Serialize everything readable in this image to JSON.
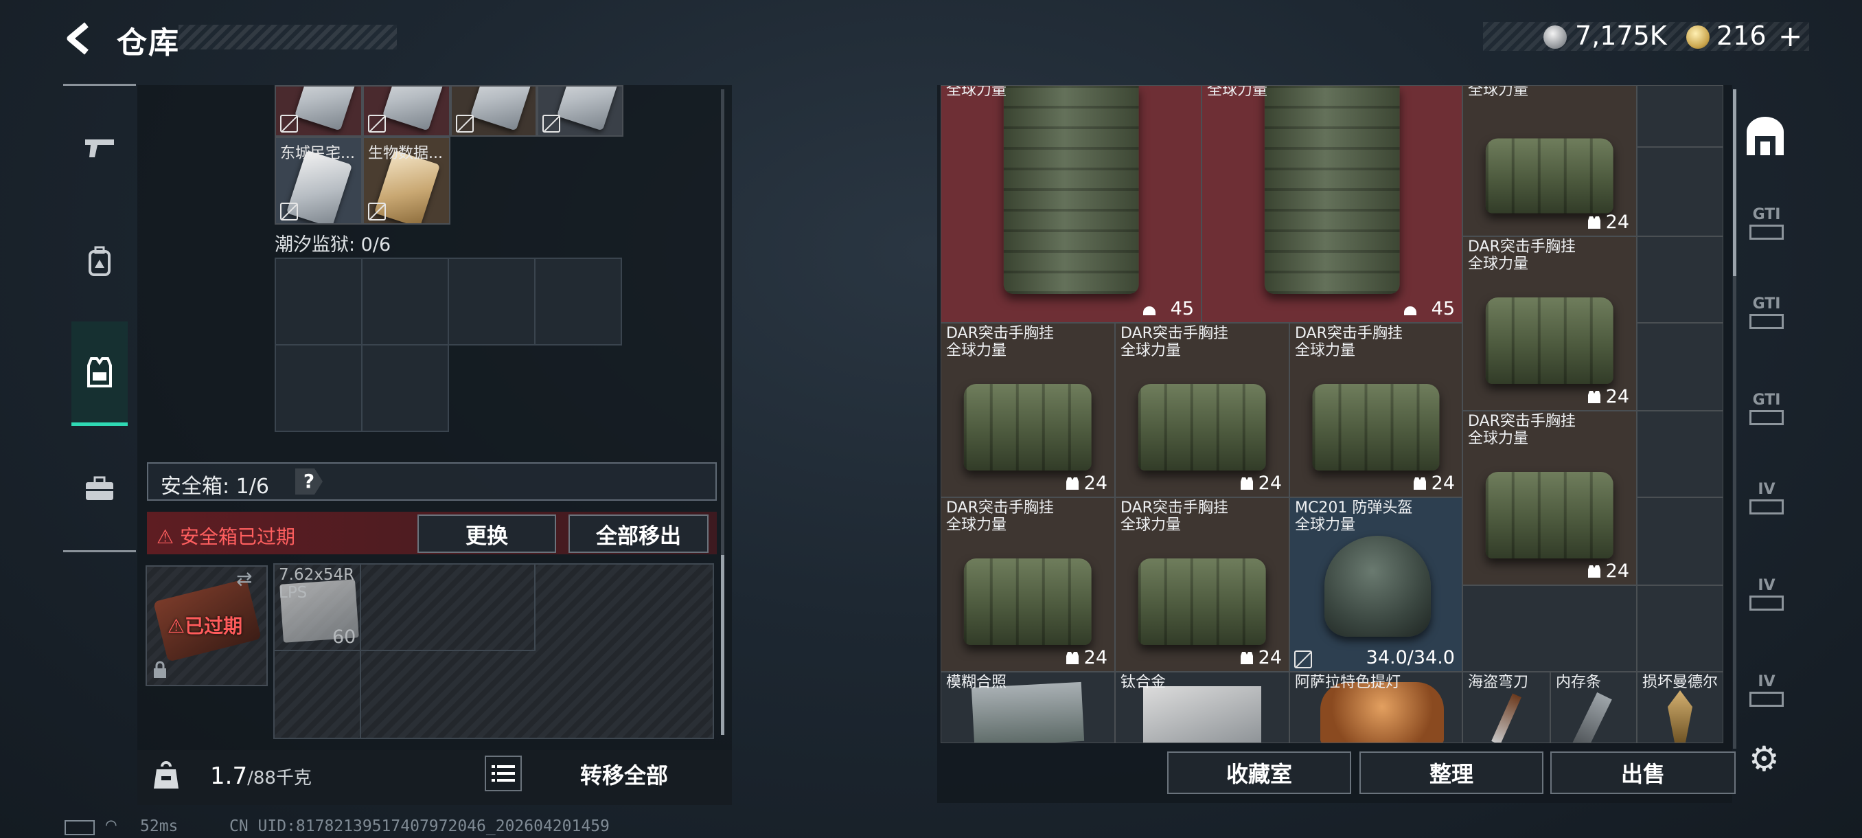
{
  "header": {
    "back_icon": "chevron-left-icon",
    "title": "仓库",
    "currency": [
      {
        "icon": "silver-coin-icon",
        "value": "7,175K"
      },
      {
        "icon": "gold-coin-icon",
        "value": "216"
      }
    ],
    "add_label": "+"
  },
  "left_nav": [
    {
      "icon": "gun-icon",
      "active": false
    },
    {
      "icon": "backpack-icon",
      "active": false
    },
    {
      "icon": "vest-icon",
      "active": true
    },
    {
      "icon": "briefcase-icon",
      "active": false
    }
  ],
  "left_panel": {
    "cards": [
      {
        "label": "东城民宅..."
      },
      {
        "label": "生物数据..."
      }
    ],
    "prison_label": "潮汐监狱: 0/6",
    "safe_box_label": "安全箱: 1/6",
    "help_label": "?",
    "warning_text": "安全箱已过期",
    "replace_button": "更换",
    "move_all_button": "全部移出",
    "expired_label": "已过期",
    "ammo": {
      "name": "7.62x54R",
      "sub": "LPS",
      "count": "60"
    },
    "weight_value": "1.7",
    "weight_max": "/88千克",
    "transfer_all_button": "转移全部"
  },
  "right_panel": {
    "items": [
      {
        "label": "全球力量",
        "count": "45",
        "count_icon": "helmet-icon"
      },
      {
        "label": "全球力量",
        "count": "45",
        "count_icon": "helmet-icon"
      },
      {
        "label": "全球力量",
        "count": "24",
        "count_icon": "vest-icon"
      },
      {
        "label": "DAR突击手胸挂\n全球力量",
        "count": "24",
        "count_icon": "vest-icon"
      },
      {
        "label": "DAR突击手胸挂\n全球力量",
        "count": "24",
        "count_icon": "vest-icon"
      },
      {
        "label": "DAR突击手胸挂\n全球力量",
        "count": "24",
        "count_icon": "vest-icon"
      },
      {
        "label": "DAR突击手胸挂\n全球力量",
        "count": "24",
        "count_icon": "vest-icon"
      },
      {
        "label": "DAR突击手胸挂\n全球力量",
        "count": "24",
        "count_icon": "vest-icon"
      },
      {
        "label": "DAR突击手胸挂\n全球力量",
        "count": "24",
        "count_icon": "vest-icon"
      },
      {
        "label": "DAR突击手胸挂\n全球力量",
        "count": "24",
        "count_icon": "vest-icon"
      },
      {
        "label": "MC201 防弹头盔\n全球力量",
        "count": "34.0/34.0",
        "count_icon": "no-lose-icon"
      }
    ],
    "bottom_items": [
      "模糊合照",
      "钛合金",
      "阿萨拉特色提灯",
      "海盗弯刀",
      "内存条",
      "损坏曼德尔"
    ],
    "collection_button": "收藏室",
    "sort_button": "整理",
    "sell_button": "出售",
    "side_tabs": [
      "GTI",
      "GTI",
      "GTI",
      "IV",
      "IV",
      "IV"
    ]
  },
  "status": {
    "ping": "52ms",
    "uid": "CN UID:8178213951740797​2046_202604201459"
  }
}
